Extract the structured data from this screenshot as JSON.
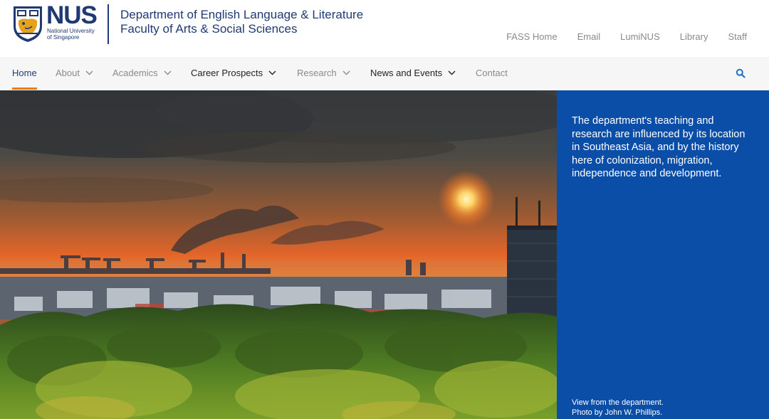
{
  "logo": {
    "name": "NUS",
    "subtitle_line1": "National University",
    "subtitle_line2": "of Singapore"
  },
  "department": {
    "line1": "Department of English Language & Literature",
    "line2": "Faculty of Arts & Social Sciences"
  },
  "utility_links": [
    "FASS Home",
    "Email",
    "LumiNUS",
    "Library",
    "Staff"
  ],
  "nav": {
    "items": [
      {
        "label": "Home"
      },
      {
        "label": "About"
      },
      {
        "label": "Academics"
      },
      {
        "label": "Career Prospects"
      },
      {
        "label": "Research"
      },
      {
        "label": "News and Events"
      },
      {
        "label": "Contact"
      }
    ],
    "search_icon": "search-icon"
  },
  "hero": {
    "panel_text": "The department's teaching and research are influenced by its location in Southeast Asia, and by the history here of colonization, migration, independence and development.",
    "caption_line1": "View from the department.",
    "caption_line2": "Photo by John W. Phillips."
  },
  "colors": {
    "brand_navy": "#1f3a73",
    "accent_orange": "#ef7c00",
    "panel_blue": "#0b4ea8"
  }
}
